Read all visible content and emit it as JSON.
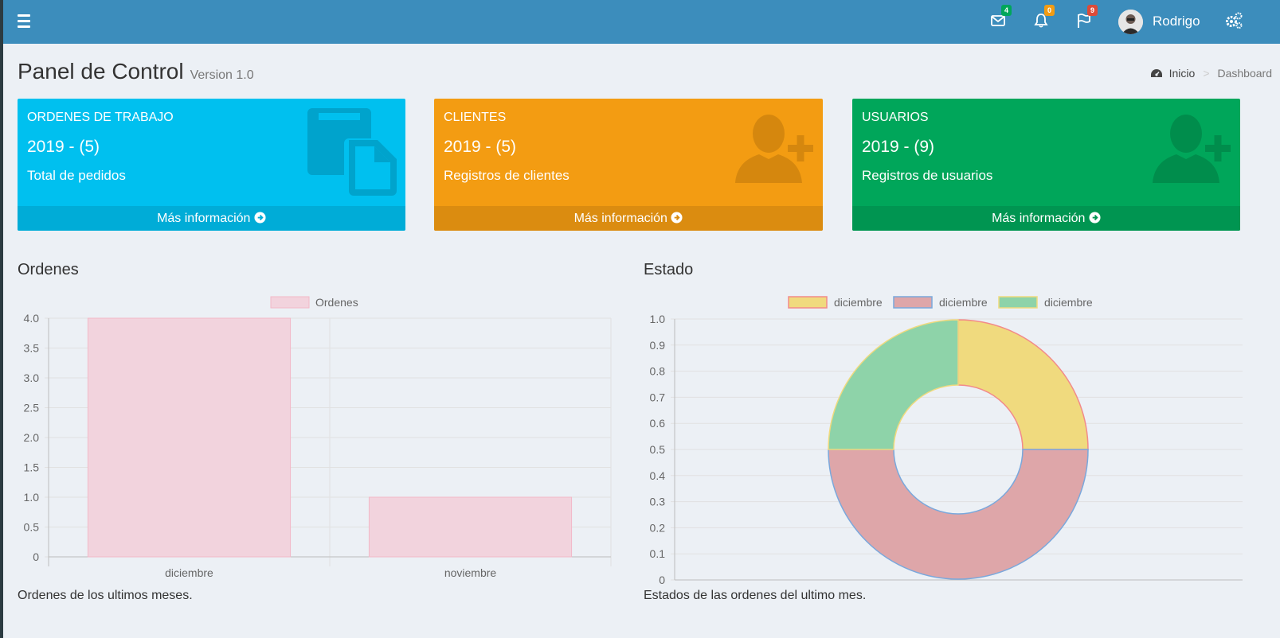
{
  "topbar": {
    "messages_badge": "4",
    "notifications_badge": "0",
    "flags_badge": "9",
    "username": "Rodrigo"
  },
  "header": {
    "title": "Panel de Control",
    "subtitle": "Version 1.0"
  },
  "breadcrumb": {
    "home": "Inicio",
    "separator": ">",
    "current": "Dashboard"
  },
  "boxes": [
    {
      "title": "ORDENES DE TRABAJO",
      "value": "2019 - (5)",
      "desc": "Total de pedidos",
      "link": "Más información",
      "color": "#00c0ef",
      "icon": "copy-icon"
    },
    {
      "title": "CLIENTES",
      "value": "2019 - (5)",
      "desc": "Registros de clientes",
      "link": "Más información",
      "color": "#f39c12",
      "icon": "user-plus-icon"
    },
    {
      "title": "USUARIOS",
      "value": "2019 - (9)",
      "desc": "Registros de usuarios",
      "link": "Más información",
      "color": "#00a65a",
      "icon": "user-plus-icon"
    }
  ],
  "sections": {
    "orders_title": "Ordenes",
    "orders_caption": "Ordenes de los ultimos meses.",
    "status_title": "Estado",
    "status_caption": "Estados de las ordenes del ultimo mes."
  },
  "chart_data": [
    {
      "type": "bar",
      "categories": [
        "diciembre",
        "noviembre"
      ],
      "series": [
        {
          "name": "Ordenes",
          "values": [
            4,
            1
          ]
        }
      ],
      "ylim": [
        0,
        4
      ],
      "yticks": [
        "4.0",
        "3.5",
        "3.0",
        "2.5",
        "2.0",
        "1.5",
        "1.0",
        "0.5",
        "0"
      ],
      "grid": true,
      "legend": "top-center",
      "colors": {
        "fill": "#f2d3dd",
        "stroke": "#f2b8c8"
      }
    },
    {
      "type": "pie",
      "variant": "doughnut",
      "labels": [
        "diciembre",
        "diciembre",
        "diciembre"
      ],
      "values": [
        1,
        2,
        1
      ],
      "yticks": [
        "1.0",
        "0.9",
        "0.8",
        "0.7",
        "0.6",
        "0.5",
        "0.4",
        "0.3",
        "0.2",
        "0.1",
        "0"
      ],
      "grid": true,
      "legend": "top-center",
      "colors": [
        "#f0da7e",
        "#dea6a9",
        "#8ed3a9"
      ],
      "border_colors": [
        "#f28a8a",
        "#7aa8dc",
        "#f0da7e"
      ]
    }
  ]
}
